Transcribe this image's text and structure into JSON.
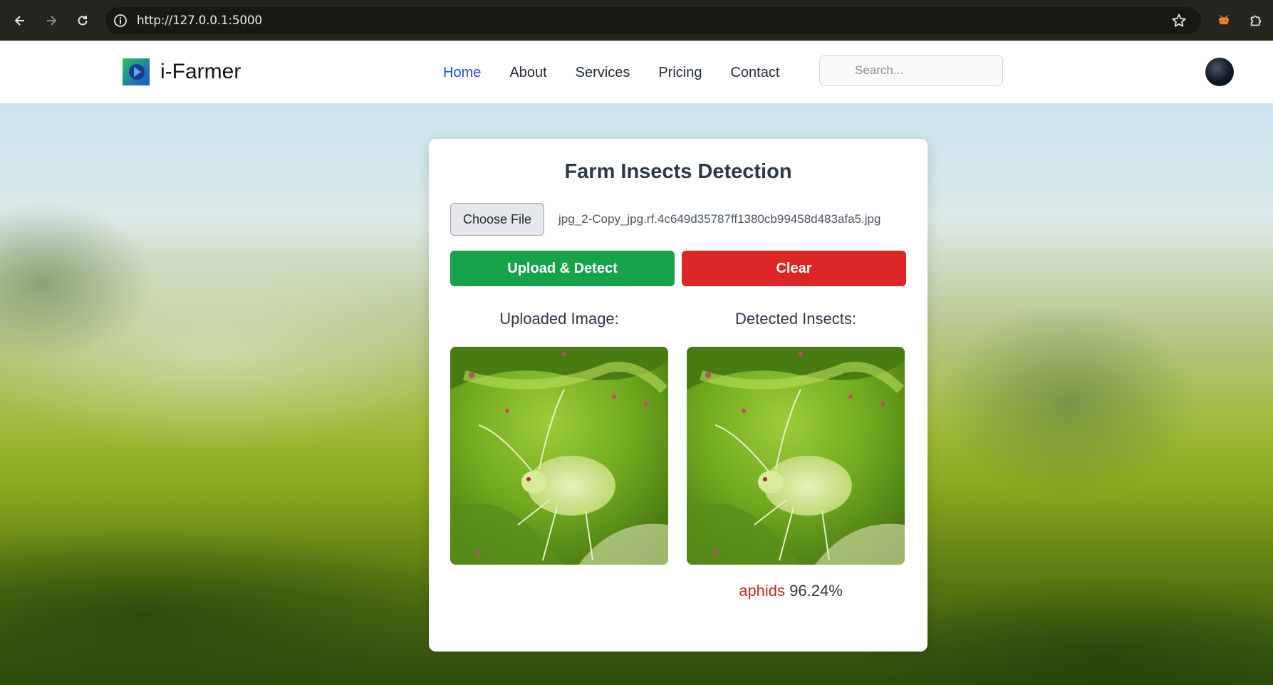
{
  "browser": {
    "url": "http://127.0.0.1:5000"
  },
  "header": {
    "brand": "i-Farmer",
    "nav": [
      {
        "label": "Home",
        "active": true
      },
      {
        "label": "About",
        "active": false
      },
      {
        "label": "Services",
        "active": false
      },
      {
        "label": "Pricing",
        "active": false
      },
      {
        "label": "Contact",
        "active": false
      }
    ],
    "search_placeholder": "Search..."
  },
  "card": {
    "title": "Farm Insects Detection",
    "choose_file_label": "Choose File",
    "file_name": "jpg_2-Copy_jpg.rf.4c649d35787ff1380cb99458d483afa5.jpg",
    "upload_button": "Upload & Detect",
    "clear_button": "Clear",
    "uploaded_label": "Uploaded Image:",
    "detected_label": "Detected Insects:",
    "detection": {
      "class_name": "aphids",
      "confidence": "96.24%"
    }
  },
  "colors": {
    "accent": "#1d4ed8",
    "upload": "#16a34a",
    "clear": "#dc2626",
    "detection_class": "#c62828"
  },
  "icons": [
    "back-arrow-icon",
    "forward-arrow-icon",
    "reload-icon",
    "site-info-icon",
    "bookmark-star-icon",
    "metamask-extension-icon",
    "extensions-puzzle-icon",
    "logo-icon",
    "avatar"
  ]
}
